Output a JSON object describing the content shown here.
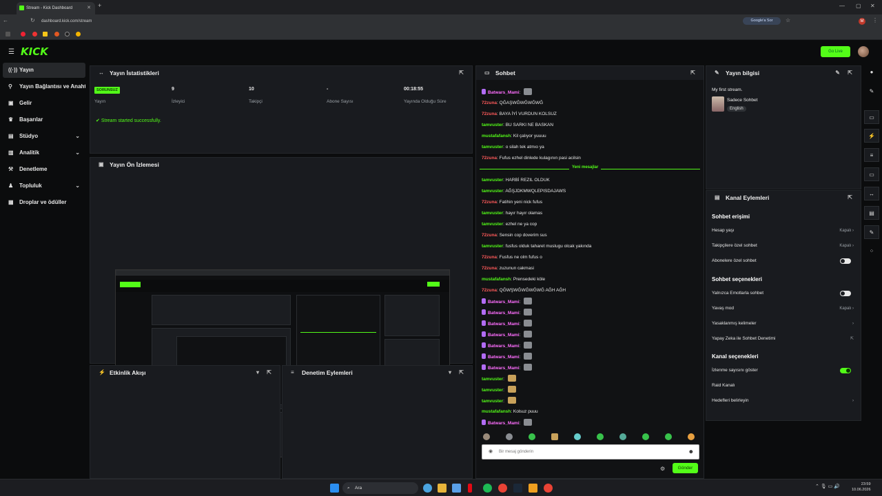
{
  "browser": {
    "tab_title": "Stream - Kick Dashboard",
    "url": "dashboard.kick.com/stream",
    "google_button": "Google'a Sor",
    "profile_letter": "M"
  },
  "header": {
    "logo": "KICK",
    "go_live": "Go Live"
  },
  "sidebar": {
    "items": [
      {
        "label": "Yayın",
        "icon": "stream-icon"
      },
      {
        "label": "Yayın Bağlantısı ve Anahtarı",
        "icon": "link-icon"
      },
      {
        "label": "Gelir",
        "icon": "wallet-icon"
      },
      {
        "label": "Başarılar",
        "icon": "trophy-icon"
      },
      {
        "label": "Stüdyo",
        "icon": "studio-icon"
      },
      {
        "label": "Analitik",
        "icon": "analytics-icon"
      },
      {
        "label": "Denetleme",
        "icon": "hammer-icon"
      },
      {
        "label": "Topluluk",
        "icon": "community-icon"
      },
      {
        "label": "Droplar ve ödüller",
        "icon": "gift-icon"
      }
    ]
  },
  "stats": {
    "title": "Yayın İstatistikleri",
    "items": [
      {
        "value": "SORUNSUZ",
        "label": "Yayın"
      },
      {
        "value": "9",
        "label": "İzleyici"
      },
      {
        "value": "10",
        "label": "Takipçi"
      },
      {
        "value": "-",
        "label": "Abone Sayısı"
      },
      {
        "value": "00:18:55",
        "label": "Yayında Olduğu Süre"
      }
    ],
    "success": "Stream started successfully."
  },
  "preview": {
    "title": "Yayın Ön İzlemesi"
  },
  "activity": {
    "title": "Etkinlik Akışı"
  },
  "moderation": {
    "title": "Denetim Eylemleri"
  },
  "chat": {
    "title": "Sohbet",
    "new_messages": "Yeni mesajlar",
    "messages_before": [
      {
        "user": "Batwars_Mami",
        "text": "",
        "color": "p",
        "badge": true,
        "emote": "gray"
      },
      {
        "user": "72zuna",
        "text": "QĞAŞWĞWĞWĞWĞ",
        "color": "r"
      },
      {
        "user": "72zuna",
        "text": "BAYA İYİ VURDUN KOLSUZ",
        "color": "r"
      },
      {
        "user": "tamvuster",
        "text": "BU SARKI NE BASKAN",
        "color": "g"
      },
      {
        "user": "mustafafansh",
        "text": "Kil çalıyor yuuuu",
        "color": "g"
      },
      {
        "user": "tamvuster",
        "text": "o silah tek atmıo ya",
        "color": "g"
      },
      {
        "user": "72zuna",
        "text": "Fufus ezhel dinlede kulagının pasi acilsin",
        "color": "r"
      }
    ],
    "messages_after": [
      {
        "user": "tamvuster",
        "text": "HARBİ REZIL OLDUK",
        "color": "g"
      },
      {
        "user": "tamvuster",
        "text": "AĞŞJDKMWQLEPISDAJAWS",
        "color": "g"
      },
      {
        "user": "72zuna",
        "text": "Fatihin yeni nick fufus",
        "color": "r"
      },
      {
        "user": "tamvuster",
        "text": "hayır hayır olamas",
        "color": "g"
      },
      {
        "user": "tamvuster",
        "text": "ezhel ne ya cop",
        "color": "g"
      },
      {
        "user": "72zuna",
        "text": "Sensin cop doverim sus",
        "color": "r"
      },
      {
        "user": "tamvuster",
        "text": "fusfus olduk taharet muslugu olcak yakında",
        "color": "g"
      },
      {
        "user": "72zuna",
        "text": "Fusfus ne olm fufus o",
        "color": "r"
      },
      {
        "user": "72zuna",
        "text": "zuzunun cakmasi",
        "color": "r"
      },
      {
        "user": "mustafafansh",
        "text": "Prensedeki köle",
        "color": "g"
      },
      {
        "user": "72zuna",
        "text": "QĞWŞWĞWĞWĞWĞ AĞH AĞH",
        "color": "r"
      },
      {
        "user": "Batwars_Mami",
        "text": "",
        "color": "p",
        "badge": true,
        "emote": "gray"
      },
      {
        "user": "Batwars_Mami",
        "text": "",
        "color": "p",
        "badge": true,
        "emote": "gray"
      },
      {
        "user": "Batwars_Mami",
        "text": "",
        "color": "p",
        "badge": true,
        "emote": "gray"
      },
      {
        "user": "Batwars_Mami",
        "text": "",
        "color": "p",
        "badge": true,
        "emote": "gray"
      },
      {
        "user": "Batwars_Mami",
        "text": "",
        "color": "p",
        "badge": true,
        "emote": "gray"
      },
      {
        "user": "Batwars_Mami",
        "text": "",
        "color": "p",
        "badge": true,
        "emote": "gray"
      },
      {
        "user": "Batwars_Mami",
        "text": "",
        "color": "p",
        "badge": true,
        "emote": "gray"
      },
      {
        "user": "tamvuster",
        "text": "",
        "color": "g",
        "emote": "yellow"
      },
      {
        "user": "tamvuster",
        "text": "",
        "color": "g",
        "emote": "yellow"
      },
      {
        "user": "tamvuster",
        "text": "",
        "color": "g",
        "emote": "yellow"
      },
      {
        "user": "mustafafansh",
        "text": "Kolsuz puuu",
        "color": "g"
      },
      {
        "user": "Batwars_Mami",
        "text": "",
        "color": "p",
        "badge": true,
        "emote": "gray"
      }
    ],
    "input_placeholder": "Bir mesaj gönderin",
    "send": "Gönder"
  },
  "stream_info": {
    "title": "Yayın bilgisi",
    "stream_title": "My first stream.",
    "category": "Sadece Sohbet",
    "language": "English"
  },
  "channel_actions": {
    "title": "Kanal Eylemleri",
    "chat_access_heading": "Sohbet erişimi",
    "chat_access": [
      {
        "label": "Hesap yaşı",
        "value": "Kapalı",
        "control": "chevron"
      },
      {
        "label": "Takipçilere özel sohbet",
        "value": "Kapalı",
        "control": "chevron"
      },
      {
        "label": "Abonelere özel sohbet",
        "value": "",
        "control": "toggle-off"
      }
    ],
    "chat_options_heading": "Sohbet seçenekleri",
    "chat_options": [
      {
        "label": "Yalnızca Emotlarla sohbet",
        "value": "",
        "control": "toggle-off"
      },
      {
        "label": "Yavaş mod",
        "value": "Kapalı",
        "control": "chevron"
      },
      {
        "label": "Yasaklanmış kelimeler",
        "value": "",
        "control": "chevron"
      },
      {
        "label": "Yapay Zeka ile Sohbet Denetimi",
        "value": "",
        "control": "external"
      }
    ],
    "channel_options_heading": "Kanal seçenekleri",
    "channel_options": [
      {
        "label": "İzlenme sayısını göster",
        "value": "",
        "control": "toggle-on"
      },
      {
        "label": "Raid Kanalı",
        "value": "",
        "control": "none"
      },
      {
        "label": "Hedefleri belirleyin",
        "value": "",
        "control": "chevron"
      }
    ]
  },
  "taskbar": {
    "search": "Ara",
    "time": "23:59",
    "date": "10.06.2026"
  }
}
